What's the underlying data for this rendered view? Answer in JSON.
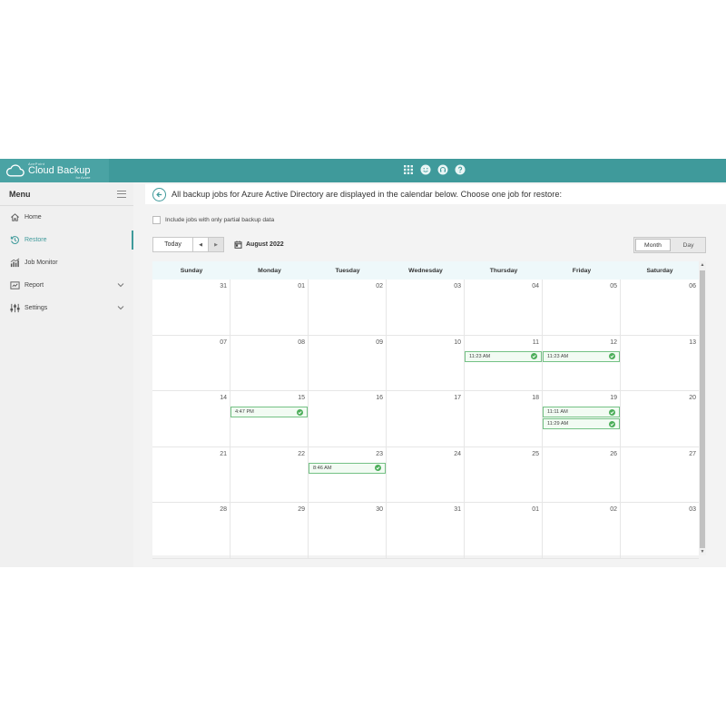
{
  "brand": {
    "vendor": "AvePoint",
    "product": "Cloud Backup",
    "edition": "for Azure"
  },
  "top_icons": [
    "apps-grid-icon",
    "smile-icon",
    "headset-icon",
    "help-icon"
  ],
  "sidebar": {
    "title": "Menu",
    "items": [
      {
        "label": "Home",
        "icon": "home-icon",
        "active": false,
        "expandable": false
      },
      {
        "label": "Restore",
        "icon": "restore-icon",
        "active": true,
        "expandable": false
      },
      {
        "label": "Job Monitor",
        "icon": "job-monitor-icon",
        "active": false,
        "expandable": false
      },
      {
        "label": "Report",
        "icon": "report-icon",
        "active": false,
        "expandable": true
      },
      {
        "label": "Settings",
        "icon": "settings-icon",
        "active": false,
        "expandable": true
      }
    ]
  },
  "header": {
    "instruction": "All backup jobs for Azure Active Directory are displayed in the calendar below. Choose one job for restore:"
  },
  "filters": {
    "partial_label": "Include jobs with only partial backup data",
    "partial_checked": false
  },
  "toolbar": {
    "today_label": "Today",
    "prev_symbol": "◀",
    "next_symbol": "▶",
    "month_label": "August 2022"
  },
  "view_switch": {
    "month_label": "Month",
    "day_label": "Day",
    "selected": "Month"
  },
  "calendar": {
    "days": [
      "Sunday",
      "Monday",
      "Tuesday",
      "Wednesday",
      "Thursday",
      "Friday",
      "Saturday"
    ],
    "weeks": [
      [
        {
          "d": "31",
          "jobs": []
        },
        {
          "d": "01",
          "jobs": []
        },
        {
          "d": "02",
          "jobs": []
        },
        {
          "d": "03",
          "jobs": []
        },
        {
          "d": "04",
          "jobs": []
        },
        {
          "d": "05",
          "jobs": []
        },
        {
          "d": "06",
          "jobs": []
        }
      ],
      [
        {
          "d": "07",
          "jobs": []
        },
        {
          "d": "08",
          "jobs": []
        },
        {
          "d": "09",
          "jobs": []
        },
        {
          "d": "10",
          "jobs": []
        },
        {
          "d": "11",
          "jobs": [
            "11:23 AM"
          ]
        },
        {
          "d": "12",
          "jobs": [
            "11:23 AM"
          ]
        },
        {
          "d": "13",
          "jobs": []
        }
      ],
      [
        {
          "d": "14",
          "jobs": []
        },
        {
          "d": "15",
          "jobs": [
            "4:47 PM"
          ]
        },
        {
          "d": "16",
          "jobs": []
        },
        {
          "d": "17",
          "jobs": []
        },
        {
          "d": "18",
          "jobs": []
        },
        {
          "d": "19",
          "jobs": [
            "11:11 AM",
            "11:29 AM"
          ]
        },
        {
          "d": "20",
          "jobs": []
        }
      ],
      [
        {
          "d": "21",
          "jobs": []
        },
        {
          "d": "22",
          "jobs": []
        },
        {
          "d": "23",
          "jobs": [
            "8:46 AM"
          ]
        },
        {
          "d": "24",
          "jobs": []
        },
        {
          "d": "25",
          "jobs": []
        },
        {
          "d": "26",
          "jobs": []
        },
        {
          "d": "27",
          "jobs": []
        }
      ],
      [
        {
          "d": "28",
          "jobs": []
        },
        {
          "d": "29",
          "jobs": []
        },
        {
          "d": "30",
          "jobs": []
        },
        {
          "d": "31",
          "jobs": []
        },
        {
          "d": "01",
          "jobs": []
        },
        {
          "d": "02",
          "jobs": []
        },
        {
          "d": "03",
          "jobs": []
        }
      ]
    ]
  },
  "colors": {
    "accent": "#3f9a9b",
    "job_border": "#74c184",
    "job_ok": "#4cae5a",
    "header_row": "#eef8fa"
  }
}
